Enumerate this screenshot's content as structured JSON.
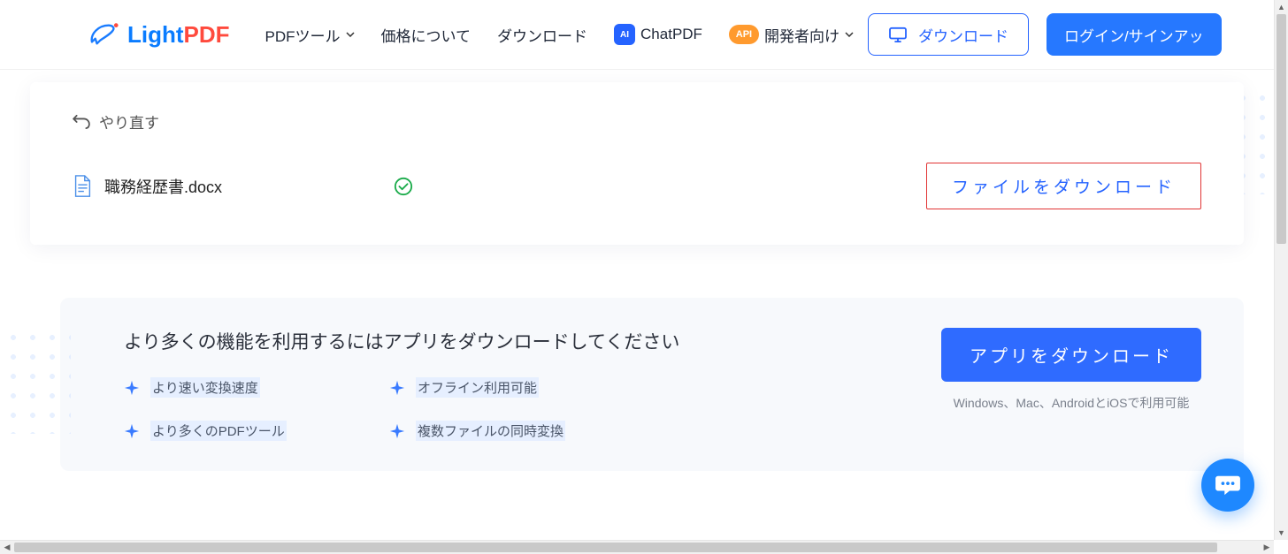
{
  "brand": {
    "light": "Light",
    "pdf": "PDF"
  },
  "nav": {
    "pdf_tools": "PDFツール",
    "pricing": "価格について",
    "download": "ダウンロード",
    "chatpdf": "ChatPDF",
    "developers": "開発者向け",
    "ai_badge": "AI",
    "api_badge": "API",
    "desktop_download": "ダウンロード",
    "login": "ログイン/サインアッ"
  },
  "redo": {
    "label": "やり直す"
  },
  "file": {
    "name": "職務経歴書.docx",
    "download_label": "ファイルをダウンロード"
  },
  "promo": {
    "title": "より多くの機能を利用するにはアプリをダウンロードしてください",
    "features": [
      "より速い変換速度",
      "オフライン利用可能",
      "より多くのPDFツール",
      "複数ファイルの同時変換"
    ],
    "button": "アプリをダウンロード",
    "platforms": "Windows、Mac、AndroidとiOSで利用可能"
  }
}
